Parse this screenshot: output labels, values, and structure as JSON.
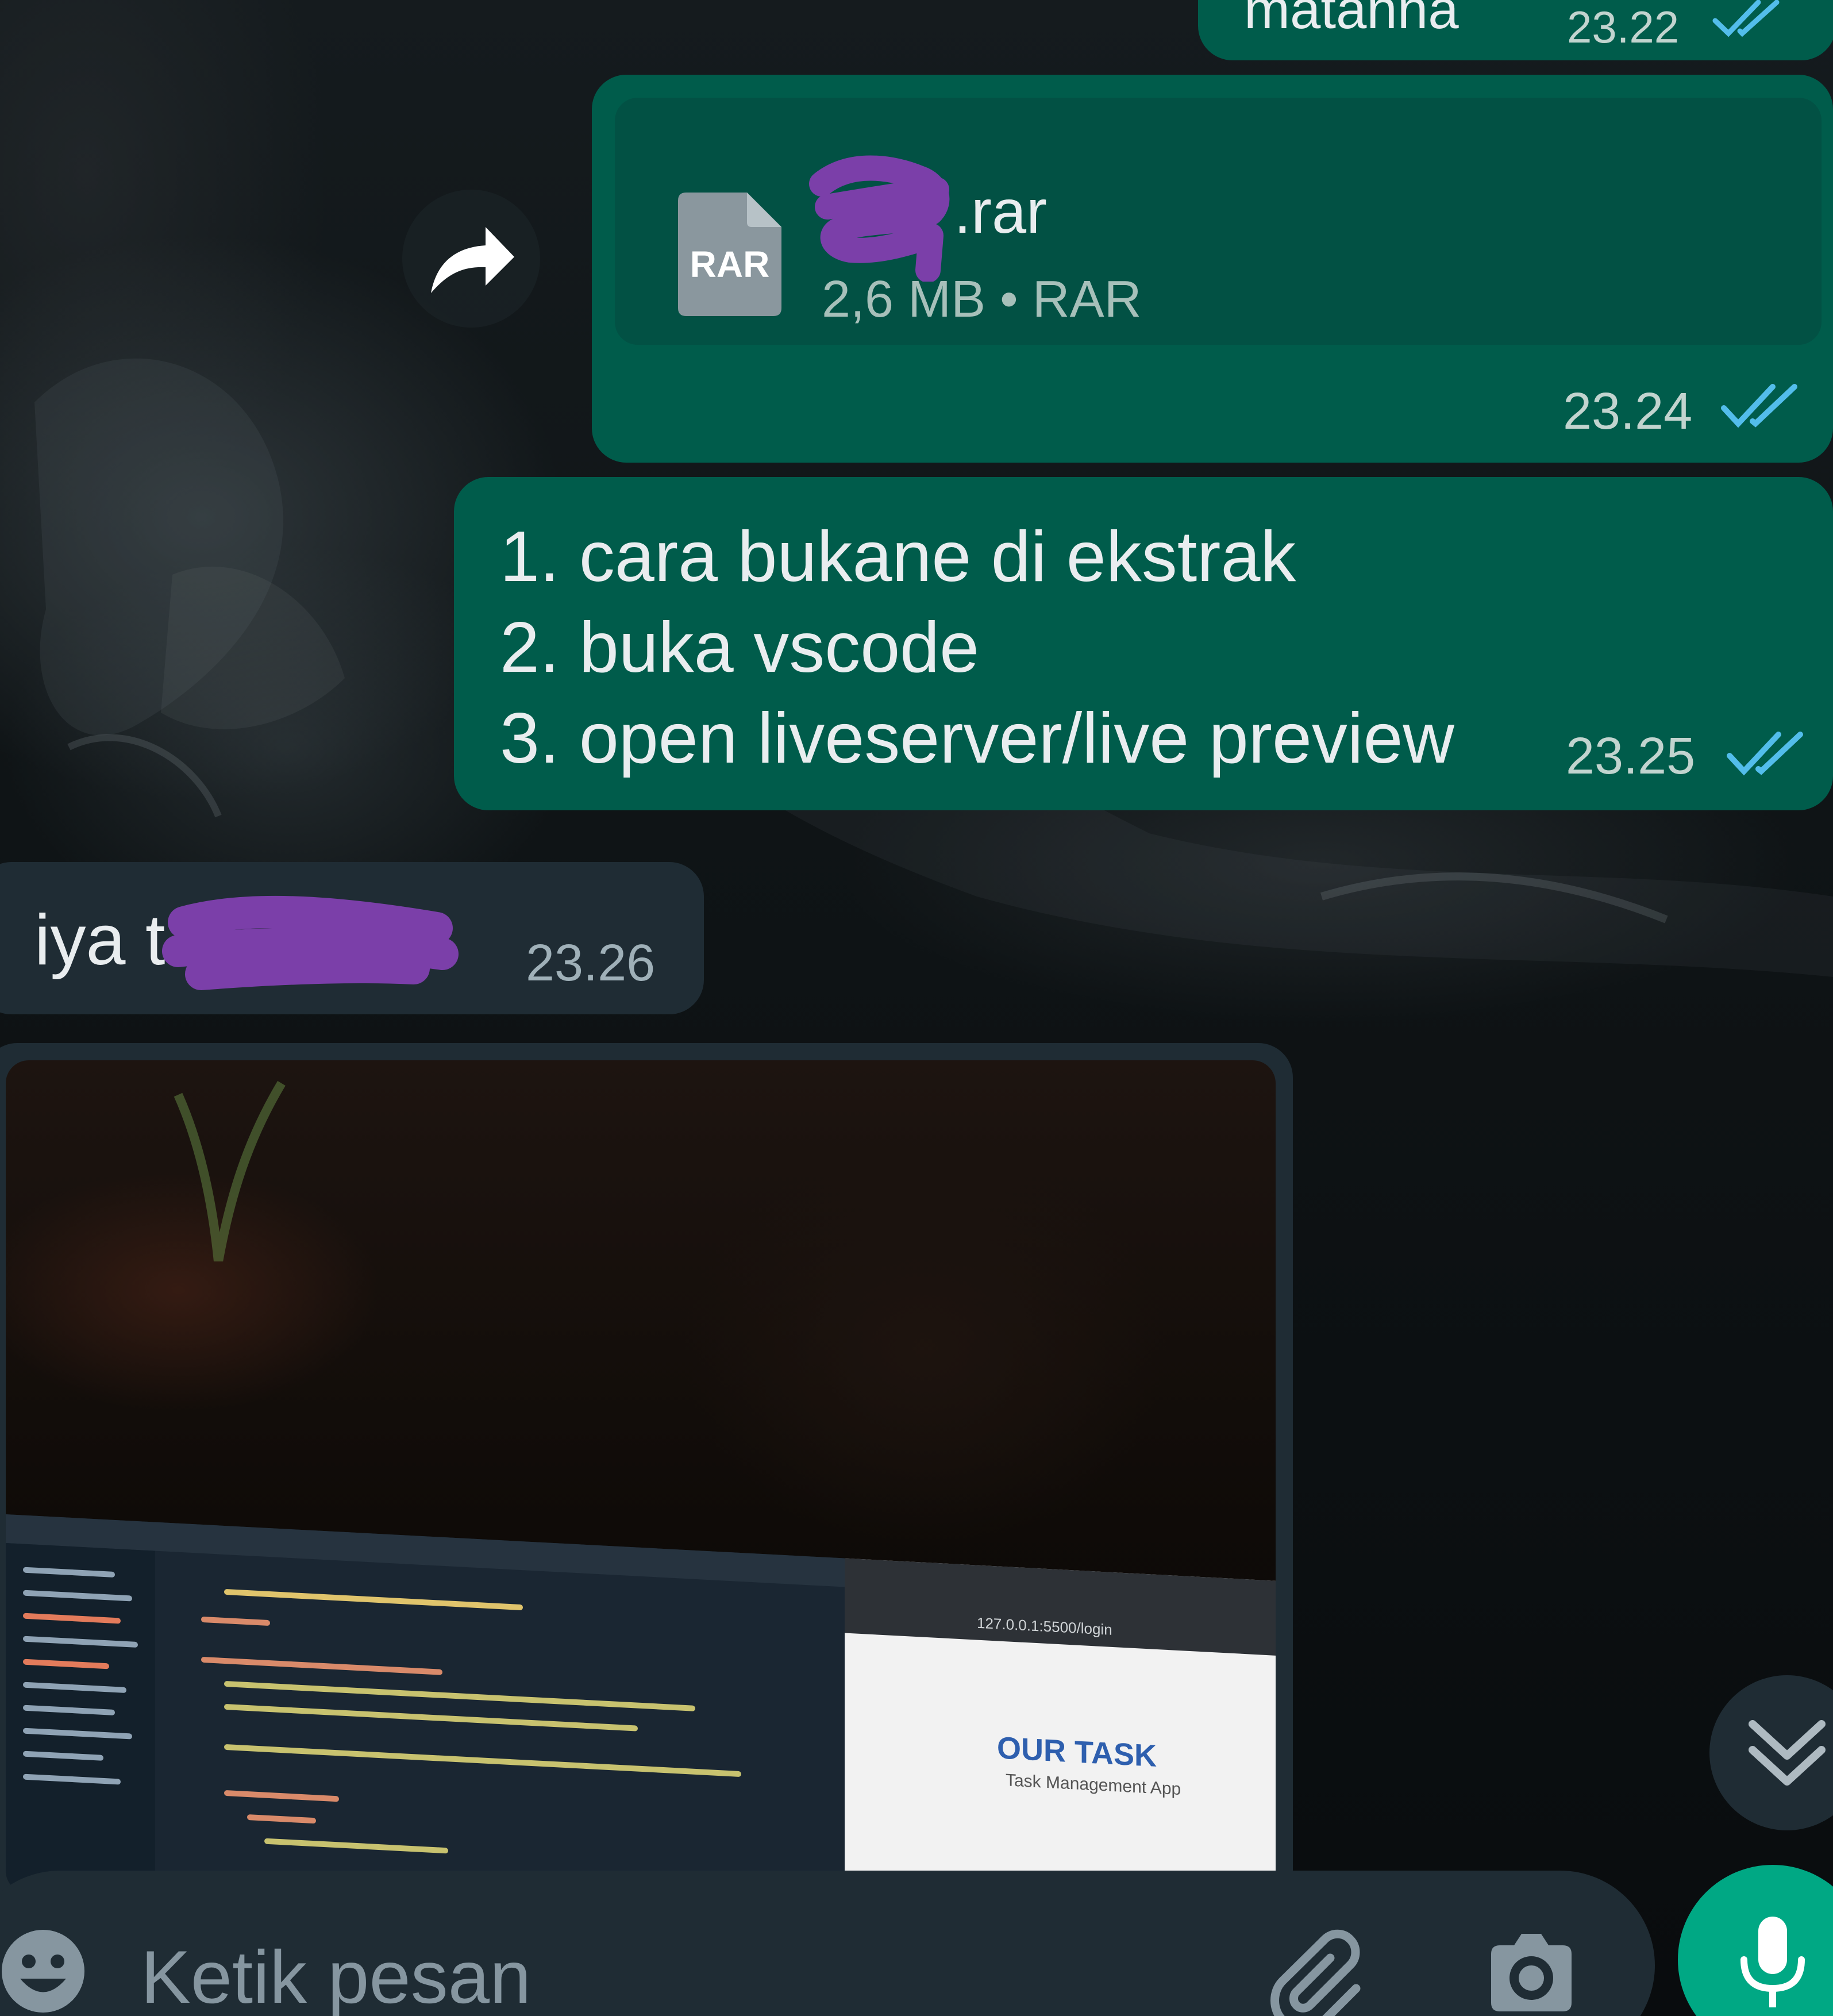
{
  "messages": {
    "top_partial": {
      "text": "matanna",
      "time": "23.22"
    },
    "file": {
      "name_suffix": ".rar",
      "icon_label": "RAR",
      "meta": "2,6 MB • RAR",
      "time": "23.24"
    },
    "steps": {
      "lines": [
        "1. cara bukane di ekstrak",
        "2. buka vscode",
        "3. open liveserver/live preview"
      ],
      "time": "23.25"
    },
    "incoming_text": {
      "visible_text": "iya t",
      "time": "23.26"
    },
    "incoming_image": {
      "app_title": "OUR TASK",
      "app_subtitle": "Task Management App",
      "url": "127.0.0.1:5500/login"
    }
  },
  "input": {
    "placeholder": "Ketik pesan"
  },
  "colors": {
    "outgoing_bubble": "#005c4b",
    "incoming_bubble": "#1f2c34",
    "read_ticks": "#53bdeb",
    "mic_button": "#00a884",
    "redaction": "#7b3fa9"
  },
  "icons": {
    "forward": "forward-arrow-icon",
    "scroll_down": "double-chevron-down-icon",
    "emoji": "emoji-icon",
    "attach": "paperclip-icon",
    "camera": "camera-icon",
    "mic": "microphone-icon",
    "read_status": "double-check-icon"
  }
}
